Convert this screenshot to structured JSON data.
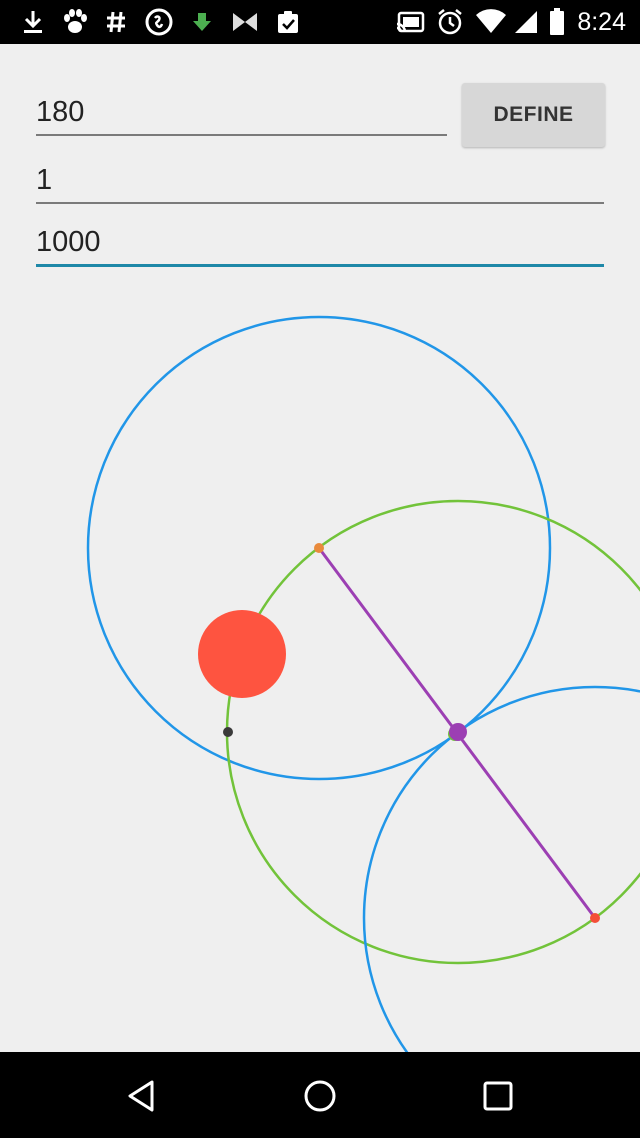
{
  "status_bar": {
    "time": "8:24",
    "left_icons": [
      "download-icon",
      "paw-icon",
      "hashtag-icon",
      "shazam-icon",
      "download-arrow-icon",
      "bowtie-icon",
      "clipboard-check-icon"
    ],
    "right_icons": [
      "cast-icon",
      "alarm-icon",
      "wifi-icon",
      "signal-icon",
      "battery-icon"
    ]
  },
  "form": {
    "field1_value": "180",
    "field2_value": "1",
    "field3_value": "1000",
    "define_label": "DEFINE"
  },
  "geometry": {
    "colors": {
      "circle_blue": "#2196e8",
      "circle_green": "#72c33a",
      "segment_purple": "#9c3fb3",
      "point_orange": "#e98a3c",
      "point_red": "#f44e38",
      "point_dark": "#3a3a3a",
      "ball_red": "#fe5440"
    }
  },
  "nav_bar": {
    "icons": [
      "back-icon",
      "home-icon",
      "recents-icon"
    ]
  }
}
